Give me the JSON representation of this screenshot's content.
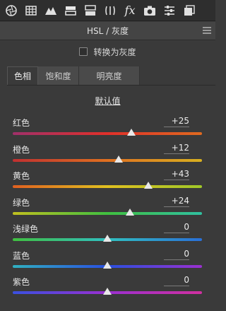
{
  "toolbar": {
    "icons": [
      "aperture-icon",
      "grid-icon",
      "mountain-icon",
      "hsl-icon",
      "split-toning-icon",
      "lens-icon",
      "fx-icon",
      "camera-icon",
      "sliders-icon",
      "presets-icon"
    ],
    "fx_label": "fx"
  },
  "panel": {
    "title": "HSL / 灰度"
  },
  "grayscale": {
    "label": "转换为灰度",
    "checked": false
  },
  "tabs": [
    {
      "label": "色相",
      "active": true
    },
    {
      "label": "饱和度",
      "active": false
    },
    {
      "label": "明亮度",
      "active": false
    }
  ],
  "default_link": "默认值",
  "sliders": [
    {
      "label": "红色",
      "value": "+25",
      "level": 25
    },
    {
      "label": "橙色",
      "value": "+12",
      "level": 12
    },
    {
      "label": "黄色",
      "value": "+43",
      "level": 43
    },
    {
      "label": "绿色",
      "value": "+24",
      "level": 24
    },
    {
      "label": "浅绿色",
      "value": "0",
      "level": 0
    },
    {
      "label": "蓝色",
      "value": "0",
      "level": 0
    },
    {
      "label": "紫色",
      "value": "0",
      "level": 0
    }
  ],
  "colors": {
    "background": "#3a3a3a",
    "toolbar": "#2e2e2e",
    "tracks": [
      [
        "#a0306a",
        "#e0302a",
        "#e06a20"
      ],
      [
        "#c03030",
        "#e07020",
        "#d8b020"
      ],
      [
        "#e06020",
        "#e0c020",
        "#a0c828"
      ],
      [
        "#c0c020",
        "#40c040",
        "#30c0a0"
      ],
      [
        "#40c040",
        "#30c0c0",
        "#2a70d8"
      ],
      [
        "#30b0c0",
        "#2a50e0",
        "#9a30d0"
      ],
      [
        "#3a50e0",
        "#9a30d0",
        "#d030a0"
      ]
    ]
  }
}
